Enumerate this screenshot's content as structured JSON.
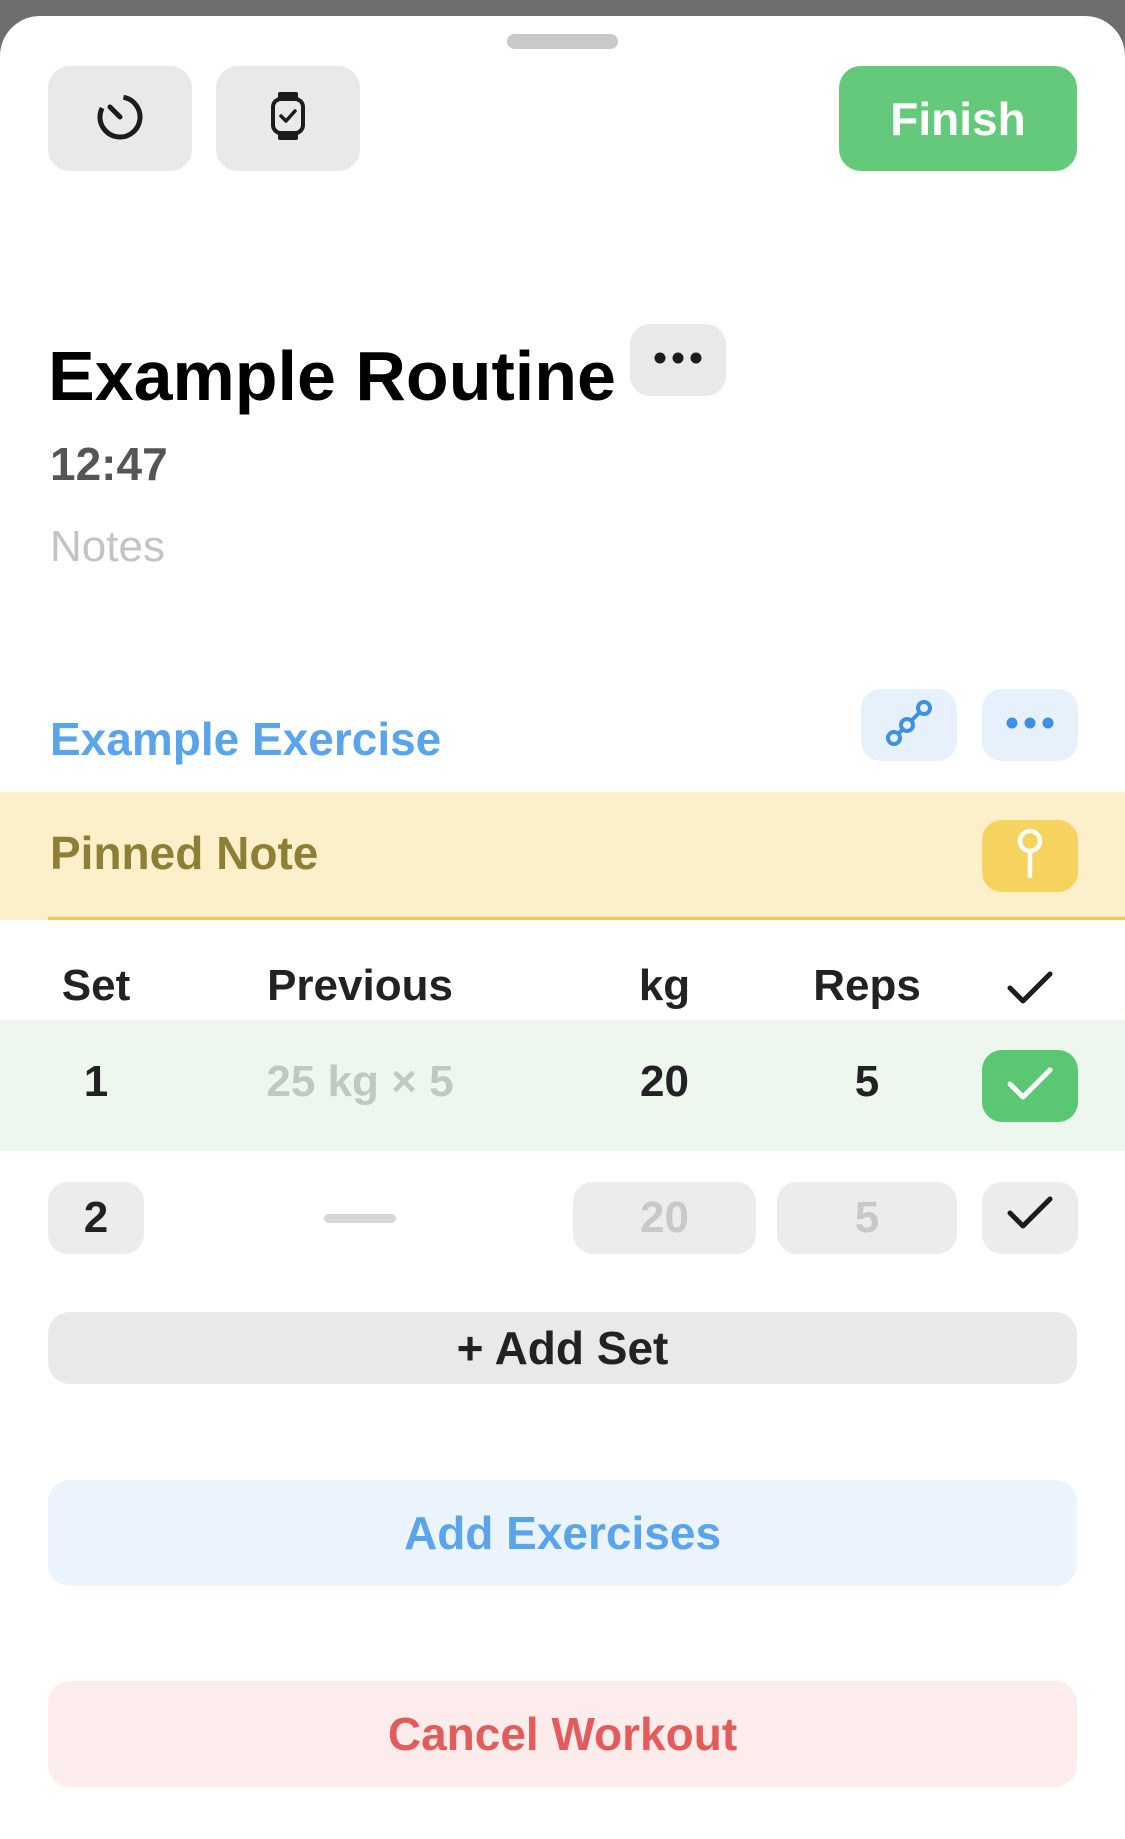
{
  "header": {
    "timer_icon": "timer-icon",
    "watch_icon": "watch-icon",
    "finish_label": "Finish"
  },
  "workout": {
    "title": "Example Routine",
    "elapsed": "12:47",
    "notes_placeholder": "Notes"
  },
  "exercise": {
    "name": "Example Exercise",
    "pinned_note": "Pinned Note",
    "columns": {
      "set": "Set",
      "previous": "Previous",
      "kg": "kg",
      "reps": "Reps"
    },
    "sets": [
      {
        "set": "1",
        "previous": "25 kg × 5",
        "kg": "20",
        "reps": "5",
        "completed": true
      },
      {
        "set": "2",
        "previous": "",
        "kg": "20",
        "reps": "5",
        "completed": false
      }
    ],
    "add_set_label": "+ Add Set"
  },
  "actions": {
    "add_exercises_label": "Add Exercises",
    "cancel_workout_label": "Cancel Workout"
  },
  "colors": {
    "accent_green": "#64c97a",
    "accent_blue": "#5aa4ec",
    "accent_red": "#e45b5b",
    "pinned_bg": "#fcf0ca"
  }
}
